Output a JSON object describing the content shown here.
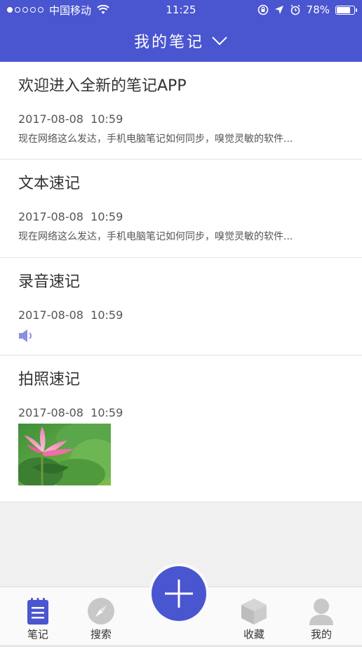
{
  "status_bar": {
    "carrier": "中国移动",
    "time": "11:25",
    "battery_percent": "78%",
    "battery_level": 0.78,
    "icons": [
      "signal-dots-icon",
      "wifi-icon",
      "rotation-lock-icon",
      "location-arrow-icon",
      "alarm-icon",
      "battery-icon"
    ]
  },
  "header": {
    "title": "我的笔记",
    "dropdown_icon": "chevron-down-icon"
  },
  "notes": [
    {
      "title": "欢迎进入全新的笔记APP",
      "time": "2017-08-08  10:59",
      "excerpt": "现在网络这么发达，手机电脑笔记如何同步，嗅觉灵敏的软件..."
    },
    {
      "title": "文本速记",
      "time": "2017-08-08  10:59",
      "excerpt": "现在网络这么发达，手机电脑笔记如何同步，嗅觉灵敏的软件..."
    },
    {
      "title": "录音速记",
      "time": "2017-08-08  10:59",
      "attachment_icon": "speaker-icon"
    },
    {
      "title": "拍照速记",
      "time": "2017-08-08  10:59",
      "attachment_icon": "lotus-photo"
    }
  ],
  "tabbar": {
    "tabs": [
      {
        "label": "笔记",
        "icon": "notebook-icon",
        "active": true
      },
      {
        "label": "搜索",
        "icon": "compass-icon",
        "active": false
      },
      {
        "label": "收藏",
        "icon": "box-icon",
        "active": false
      },
      {
        "label": "我的",
        "icon": "user-icon",
        "active": false
      }
    ],
    "add_icon": "plus-icon"
  },
  "colors": {
    "accent": "#4a55d0",
    "tab_icon_inactive": "#c8c8c8",
    "background": "#f0f0f0"
  }
}
